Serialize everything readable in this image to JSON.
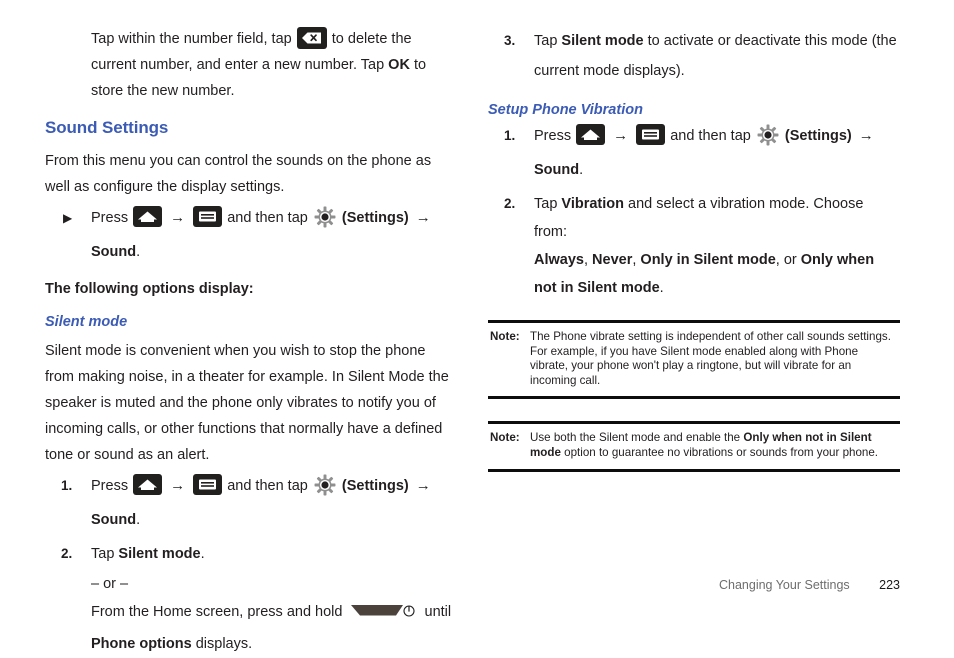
{
  "page": {
    "footer_chapter": "Changing Your Settings",
    "footer_page_number": "223",
    "accent_color": "#3b5bb5",
    "text_color": "#231f20"
  },
  "left_column": {
    "intro_paragraph": {
      "part1": "Tap within the number field, tap",
      "part2": "to delete the current number, and enter a new number. Tap",
      "bold_ok": "OK",
      "part3": "to store the new number.",
      "icon": "backspace-delete-key-icon"
    },
    "section_heading": "Sound Settings",
    "body_paragraph": "From this menu you can control the sounds on the phone as well as configure the display settings.",
    "bullet_step": {
      "marker": "▶",
      "press": "Press",
      "home_icon": "home-key-icon",
      "arrow": "→",
      "menu_icon": "menu-key-icon",
      "and_then_tap": "and then tap",
      "gear_icon": "settings-gear-icon",
      "settings_label": "(Settings)",
      "arrow2": "→",
      "target": "Sound",
      "period": "."
    },
    "lead_in": "The following options display:",
    "sub_heading": "Silent mode",
    "silent_paragraph": "Silent mode is convenient when you wish to stop the phone from making noise, in a theater for example. In Silent Mode the speaker is muted and the phone only vibrates to notify you of incoming calls, or other functions that normally have a defined tone or sound as an alert.",
    "steps": [
      {
        "marker": "1.",
        "press": "Press",
        "home_icon": "home-key-icon",
        "arrow": "→",
        "menu_icon": "menu-key-icon",
        "and_then_tap": "and then tap",
        "gear_icon": "settings-gear-icon",
        "settings_label": "(Settings)",
        "arrow2": "→",
        "target": "Sound",
        "period": "."
      },
      {
        "marker": "2.",
        "tap": "Tap",
        "target": "Silent mode",
        "period": "."
      }
    ],
    "or_divider": "– or –",
    "alt_instruction": {
      "part1": "From the Home screen, press and hold",
      "power_icon": "power-key-icon",
      "part2": "until",
      "bold_target": "Phone options",
      "part3": "displays."
    }
  },
  "right_column": {
    "step3": {
      "marker": "3.",
      "tap": "Tap",
      "target": "Silent mode",
      "rest": "to activate or deactivate this mode (the current mode displays)."
    },
    "sub_heading": "Setup Phone Vibration",
    "steps": [
      {
        "marker": "1.",
        "press": "Press",
        "home_icon": "home-key-icon",
        "arrow": "→",
        "menu_icon": "menu-key-icon",
        "and_then_tap": "and then tap",
        "gear_icon": "settings-gear-icon",
        "settings_label": "(Settings)",
        "arrow2": "→",
        "target": "Sound",
        "period": "."
      },
      {
        "marker": "2.",
        "tap": "Tap",
        "bold_vibration": "Vibration",
        "rest": "and select a vibration mode. Choose from:",
        "options": [
          "Always",
          "Never",
          "Only in Silent mode",
          "Only when not in Silent mode"
        ],
        "sep1": ",",
        "sep2": ",",
        "sep3": ", or",
        "period": "."
      }
    ],
    "notes": [
      {
        "label": "Note:",
        "text": "The Phone vibrate setting is independent of other call sounds settings. For example, if you have Silent mode enabled along with Phone vibrate, your phone won't play a ringtone, but will vibrate for an incoming call."
      },
      {
        "label": "Note:",
        "text_part1": "Use both the Silent mode and enable the",
        "bold_option": "Only when not in Silent mode",
        "text_part2": "option to guarantee no vibrations or sounds from your phone."
      }
    ]
  }
}
